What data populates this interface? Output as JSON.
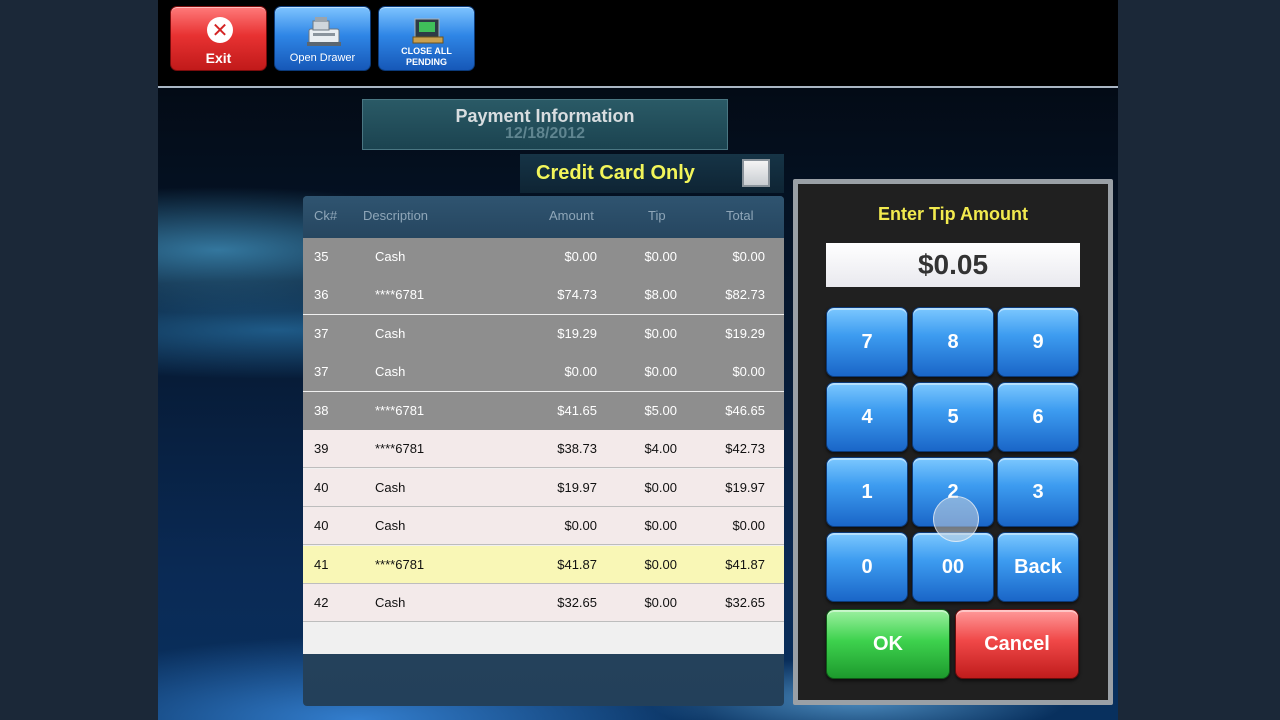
{
  "toolbar": {
    "exit_label": "Exit",
    "open_drawer_label": "Open Drawer",
    "close_all_label_1": "CLOSE ALL",
    "close_all_label_2": "PENDING"
  },
  "payment": {
    "title": "Payment Information",
    "date": "12/18/2012",
    "credit_card_only_label": "Credit Card Only",
    "credit_card_only_checked": false
  },
  "table": {
    "headers": {
      "ck": "Ck#",
      "description": "Description",
      "amount": "Amount",
      "tip": "Tip",
      "total": "Total"
    },
    "rows": [
      {
        "ck": "35",
        "description": "Cash",
        "amount": "$0.00",
        "tip": "$0.00",
        "total": "$0.00",
        "state": "gray"
      },
      {
        "ck": "36",
        "description": "****6781",
        "amount": "$74.73",
        "tip": "$8.00",
        "total": "$82.73",
        "state": "gray"
      },
      {
        "ck": "37",
        "description": "Cash",
        "amount": "$19.29",
        "tip": "$0.00",
        "total": "$19.29",
        "state": "gray"
      },
      {
        "ck": "37",
        "description": "Cash",
        "amount": "$0.00",
        "tip": "$0.00",
        "total": "$0.00",
        "state": "gray"
      },
      {
        "ck": "38",
        "description": "****6781",
        "amount": "$41.65",
        "tip": "$5.00",
        "total": "$46.65",
        "state": "gray"
      },
      {
        "ck": "39",
        "description": "****6781",
        "amount": "$38.73",
        "tip": "$4.00",
        "total": "$42.73",
        "state": "light"
      },
      {
        "ck": "40",
        "description": "Cash",
        "amount": "$19.97",
        "tip": "$0.00",
        "total": "$19.97",
        "state": "light"
      },
      {
        "ck": "40",
        "description": "Cash",
        "amount": "$0.00",
        "tip": "$0.00",
        "total": "$0.00",
        "state": "light"
      },
      {
        "ck": "41",
        "description": "****6781",
        "amount": "$41.87",
        "tip": "$0.00",
        "total": "$41.87",
        "state": "selected"
      },
      {
        "ck": "42",
        "description": "Cash",
        "amount": "$32.65",
        "tip": "$0.00",
        "total": "$32.65",
        "state": "light"
      }
    ]
  },
  "keypad": {
    "title": "Enter Tip Amount",
    "display_value": "$0.05",
    "keys": {
      "k7": "7",
      "k8": "8",
      "k9": "9",
      "k4": "4",
      "k5": "5",
      "k6": "6",
      "k1": "1",
      "k2": "2",
      "k3": "3",
      "k0": "0",
      "k00": "00",
      "back": "Back",
      "ok": "OK",
      "cancel": "Cancel"
    }
  },
  "colors": {
    "accent_yellow": "#f2ea4e",
    "selected_row": "#f9f7b6",
    "processed_row": "#8e8e8e",
    "pending_row": "#f3eaea"
  }
}
